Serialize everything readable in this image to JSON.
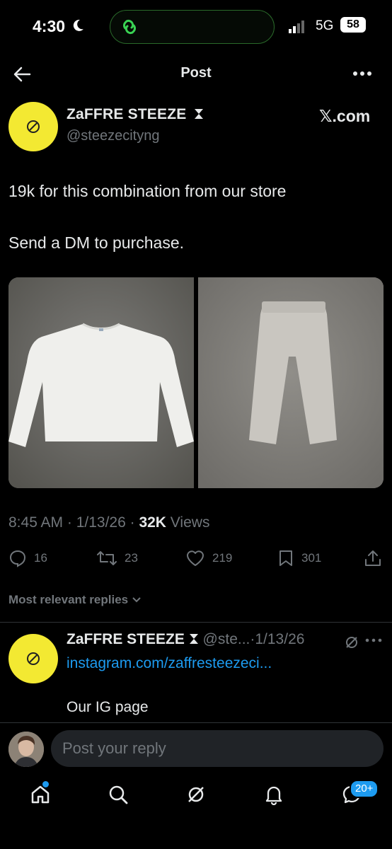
{
  "status_bar": {
    "time": "4:30",
    "network": "5G",
    "battery": "58"
  },
  "header": {
    "title": "Post"
  },
  "post": {
    "author_name": "ZaFFRE STEEZE",
    "author_handle": "@steezecityng",
    "source_label": "𝕏.com",
    "text_line1": "19k for this combination from our store",
    "text_line2": "Send a DM to purchase.",
    "timestamp": "8:45 AM · 1/13/26 · ",
    "views_count": "32K",
    "views_label": " Views",
    "replies": "16",
    "reposts": "23",
    "likes": "219",
    "bookmarks": "301"
  },
  "replies_filter": "Most relevant replies",
  "reply": {
    "author_name": "ZaFFRE STEEZE",
    "handle_date": " @ste...·1/13/26",
    "link": "instagram.com/zaffresteezeci...",
    "text": "Our IG page"
  },
  "compose": {
    "placeholder": "Post your reply"
  },
  "nav": {
    "messages_badge": "20+"
  },
  "colors": {
    "accent": "#1d9bf0",
    "muted": "#71767b",
    "avatar_yellow": "#f3e932"
  },
  "icons": [
    "back-arrow-icon",
    "more-icon",
    "hourglass-icon",
    "x-logo",
    "reply-icon",
    "repost-icon",
    "heart-icon",
    "bookmark-icon",
    "share-icon",
    "chevron-down-icon",
    "grok-icon",
    "home-icon",
    "search-icon",
    "bell-icon",
    "messages-icon"
  ]
}
